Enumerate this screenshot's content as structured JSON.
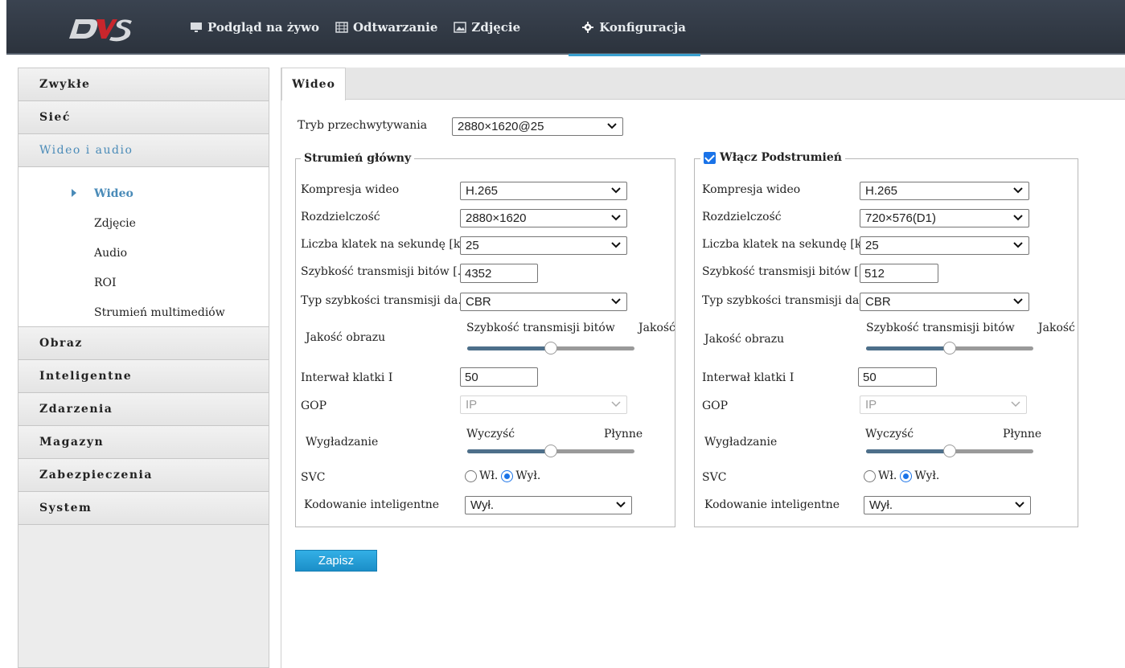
{
  "brand": {
    "logo_text": "DVS",
    "accent": "#3aa0cf",
    "link_color": "#4a8bb8"
  },
  "nav": {
    "items": [
      {
        "label": "Podgląd na żywo",
        "icon": "monitor-icon"
      },
      {
        "label": "Odtwarzanie",
        "icon": "film-icon"
      },
      {
        "label": "Zdjęcie",
        "icon": "image-icon"
      },
      {
        "label": "Konfiguracja",
        "icon": "gear-icon",
        "active": true
      }
    ]
  },
  "sidebar": {
    "groups_before": [
      "Zwykłe",
      "Sieć"
    ],
    "open_group": "Wideo i audio",
    "sub_items": [
      "Wideo",
      "Zdjęcie",
      "Audio",
      "ROI",
      "Strumień multimediów"
    ],
    "active_sub": "Wideo",
    "groups_after": [
      "Obraz",
      "Inteligentne",
      "Zdarzenia",
      "Magazyn",
      "Zabezpieczenia",
      "System"
    ]
  },
  "tab": {
    "label": "Wideo"
  },
  "capture": {
    "label": "Tryb przechwytywania",
    "value": "2880×1620@25"
  },
  "main_stream": {
    "title": "Strumień główny",
    "compression": {
      "label": "Kompresja wideo",
      "value": "H.265"
    },
    "resolution": {
      "label": "Rozdzielczość",
      "value": "2880×1620"
    },
    "fps": {
      "label": "Liczba klatek na sekundę [kl/s]",
      "value": "25"
    },
    "bitrate": {
      "label": "Szybkość transmisji bitów [...",
      "value": "4352"
    },
    "bitrate_type": {
      "label": "Typ szybkości transmisji da...",
      "value": "CBR"
    },
    "quality": {
      "label": "Jakość obrazu",
      "left": "Szybkość transmisji bitów",
      "right": "Jakość",
      "level": 0.5
    },
    "iframe": {
      "label": "Interwał klatki I",
      "value": "50"
    },
    "gop": {
      "label": "GOP",
      "value": "IP"
    },
    "smoothing": {
      "label": "Wygładzanie",
      "left": "Wyczyść",
      "right": "Płynne",
      "level": 0.5
    },
    "svc": {
      "label": "SVC",
      "on": "Wł.",
      "off": "Wył.",
      "selected": "off"
    },
    "smart": {
      "label": "Kodowanie inteligentne",
      "value": "Wył."
    }
  },
  "sub_stream": {
    "title": "Włącz Podstrumień",
    "enabled": true,
    "compression": {
      "label": "Kompresja wideo",
      "value": "H.265"
    },
    "resolution": {
      "label": "Rozdzielczość",
      "value": "720×576(D1)"
    },
    "fps": {
      "label": "Liczba klatek na sekundę [kl/s]",
      "value": "25"
    },
    "bitrate": {
      "label": "Szybkość transmisji bitów [...",
      "value": "512"
    },
    "bitrate_type": {
      "label": "Typ szybkości transmisji da...",
      "value": "CBR"
    },
    "quality": {
      "label": "Jakość obrazu",
      "left": "Szybkość transmisji bitów",
      "right": "Jakość",
      "level": 0.5
    },
    "iframe": {
      "label": "Interwał klatki I",
      "value": "50"
    },
    "gop": {
      "label": "GOP",
      "value": "IP"
    },
    "smoothing": {
      "label": "Wygładzanie",
      "left": "Wyczyść",
      "right": "Płynne",
      "level": 0.5
    },
    "svc": {
      "label": "SVC",
      "on": "Wł.",
      "off": "Wył.",
      "selected": "off"
    },
    "smart": {
      "label": "Kodowanie inteligentne",
      "value": "Wył."
    }
  },
  "actions": {
    "save": "Zapisz"
  }
}
